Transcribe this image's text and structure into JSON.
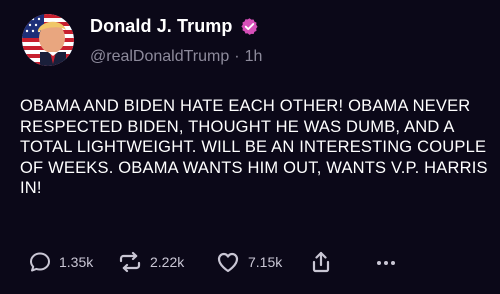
{
  "post": {
    "author": {
      "display_name": "Donald J. Trump",
      "handle": "@realDonaldTrump",
      "verified_icon": "verified-badge-icon",
      "avatar": "avatar-image"
    },
    "separator": "·",
    "time_ago": "1h",
    "text": "OBAMA AND BIDEN HATE EACH OTHER! OBAMA NEVER RESPECTED BIDEN, THOUGHT HE WAS DUMB, AND A TOTAL LIGHTWEIGHT. WILL BE AN INTERESTING COUPLE OF WEEKS. OBAMA WANTS HIM OUT, WANTS V.P. HARRIS IN!"
  },
  "actions": {
    "replies": "1.35k",
    "reposts": "2.22k",
    "likes": "7.15k",
    "reply_icon": "reply-icon",
    "repost_icon": "repost-icon",
    "like_icon": "heart-icon",
    "share_icon": "share-icon",
    "more_icon": "more-icon"
  },
  "colors": {
    "background": "#0b0818",
    "text": "#ffffff",
    "muted": "#8d8a9b",
    "verified": "#d64fb8"
  }
}
